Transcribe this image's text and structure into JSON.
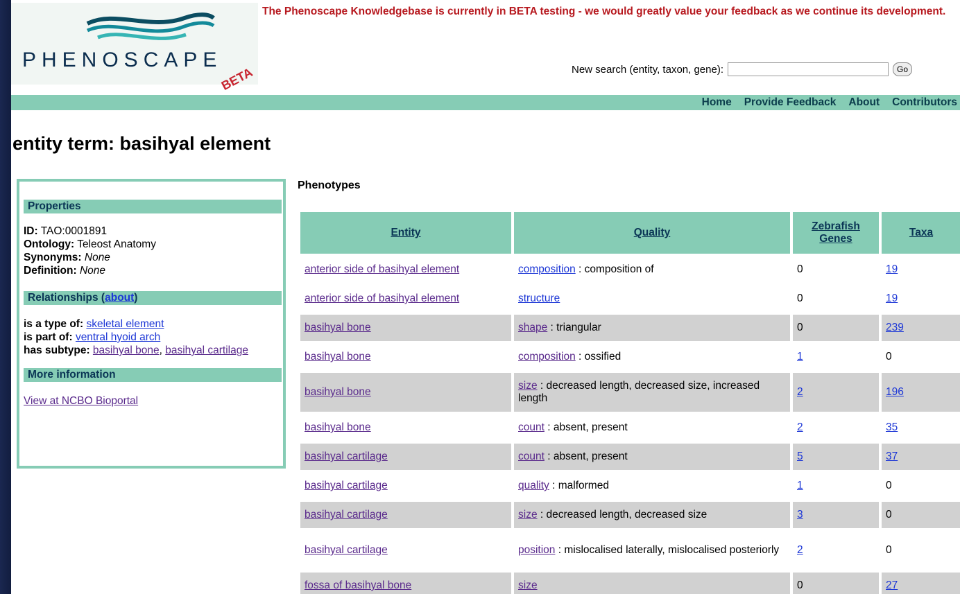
{
  "banner": "The Phenoscape Knowledgebase is currently in BETA testing - we would greatly value your feedback as we continue its development.",
  "logo": {
    "word": "PHENOSCAPE",
    "beta": "BETA"
  },
  "search": {
    "label": "New search (entity, taxon, gene):",
    "value": "",
    "go": "Go"
  },
  "nav": [
    "Home",
    "Provide Feedback",
    "About",
    "Contributors"
  ],
  "title": "entity term: basihyal element",
  "properties": {
    "header": "Properties",
    "id_label": "ID:",
    "id": "TAO:0001891",
    "ontology_label": "Ontology:",
    "ontology": "Teleost Anatomy",
    "synonyms_label": "Synonyms:",
    "synonyms": "None",
    "definition_label": "Definition:",
    "definition": "None"
  },
  "relationships": {
    "header": "Relationships (",
    "about": "about",
    "close": ")",
    "is_type_label": "is a type of:",
    "is_type": "skeletal element",
    "part_of_label": "is part of:",
    "part_of": "ventral hyoid arch",
    "subtype_label": "has subtype:",
    "subtype1": "basihyal bone",
    "sep": ", ",
    "subtype2": "basihyal cartilage"
  },
  "more": {
    "header": "More information",
    "link": "View at NCBO Bioportal"
  },
  "phenotypes": {
    "title": "Phenotypes",
    "headers": [
      "Entity",
      "Quality",
      "Zebrafish Genes",
      "Taxa"
    ],
    "rows": [
      {
        "entity": "anterior side of basihyal element",
        "q": "composition",
        "qd": " : composition of",
        "genes": "0",
        "taxa": "19",
        "g": false
      },
      {
        "entity": "anterior side of basihyal element",
        "q": "structure",
        "qd": "",
        "genes": "0",
        "taxa": "19",
        "g": false
      },
      {
        "entity": "basihyal bone",
        "q": "shape",
        "qd": " : triangular",
        "genes": "0",
        "taxa": "239",
        "g": true
      },
      {
        "entity": "basihyal bone",
        "q": "composition",
        "qd": " : ossified",
        "genes": "1",
        "taxa": "0",
        "g": false
      },
      {
        "entity": "basihyal bone",
        "q": "size",
        "qd": " : decreased length, decreased size, increased length",
        "genes": "2",
        "taxa": "196",
        "g": true
      },
      {
        "entity": "basihyal bone",
        "q": "count",
        "qd": " : absent, present",
        "genes": "2",
        "taxa": "35",
        "g": false
      },
      {
        "entity": "basihyal cartilage",
        "q": "count",
        "qd": " : absent, present",
        "genes": "5",
        "taxa": "37",
        "g": true
      },
      {
        "entity": "basihyal cartilage",
        "q": "quality",
        "qd": " : malformed",
        "genes": "1",
        "taxa": "0",
        "g": false
      },
      {
        "entity": "basihyal cartilage",
        "q": "size",
        "qd": " : decreased length, decreased size",
        "genes": "3",
        "taxa": "0",
        "g": true
      },
      {
        "entity": "basihyal cartilage",
        "q": "position",
        "qd": " : mislocalised laterally, mislocalised posteriorly",
        "genes": "2",
        "taxa": "0",
        "g": false
      },
      {
        "entity": "fossa of basihyal bone",
        "q": "size",
        "qd": "",
        "genes": "0",
        "taxa": "27",
        "g": true
      }
    ]
  }
}
